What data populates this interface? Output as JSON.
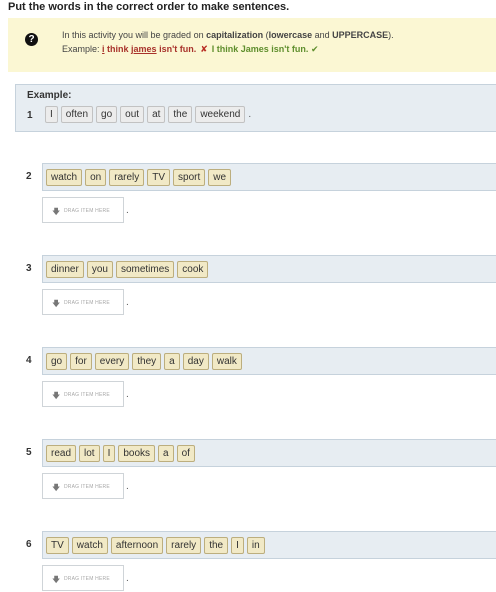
{
  "title": "Put the words in the correct order to make sentences.",
  "notice": {
    "icon": "question-icon",
    "line1_pre": "In this activity you will be graded on ",
    "line1_cap": "capitalization",
    "line1_mid": " (",
    "line1_lower": "lowercase",
    "line1_and": " and ",
    "line1_upper": "UPPERCASE",
    "line1_end": ").",
    "line2_pre": "Example: ",
    "wrong_i": "i",
    "wrong_think": " think ",
    "wrong_james": "james",
    "wrong_rest": " isn't fun.",
    "x_mark": "✘",
    "right_example": "I think James isn't fun.",
    "check_mark": "✔"
  },
  "example": {
    "label": "Example:",
    "number": "1",
    "words": [
      "I",
      "often",
      "go",
      "out",
      "at",
      "the",
      "weekend"
    ],
    "period": "."
  },
  "questions": [
    {
      "number": "2",
      "words": [
        "watch",
        "on",
        "rarely",
        "TV",
        "sport",
        "we"
      ]
    },
    {
      "number": "3",
      "words": [
        "dinner",
        "you",
        "sometimes",
        "cook"
      ]
    },
    {
      "number": "4",
      "words": [
        "go",
        "for",
        "every",
        "they",
        "a",
        "day",
        "walk"
      ]
    },
    {
      "number": "5",
      "words": [
        "read",
        "lot",
        "I",
        "books",
        "a",
        "of"
      ]
    },
    {
      "number": "6",
      "words": [
        "TV",
        "watch",
        "afternoon",
        "rarely",
        "the",
        "I",
        "in"
      ]
    }
  ],
  "drop_hint": "DRAG ITEM HERE",
  "drop_icon": "download-arrow-icon",
  "period": "."
}
